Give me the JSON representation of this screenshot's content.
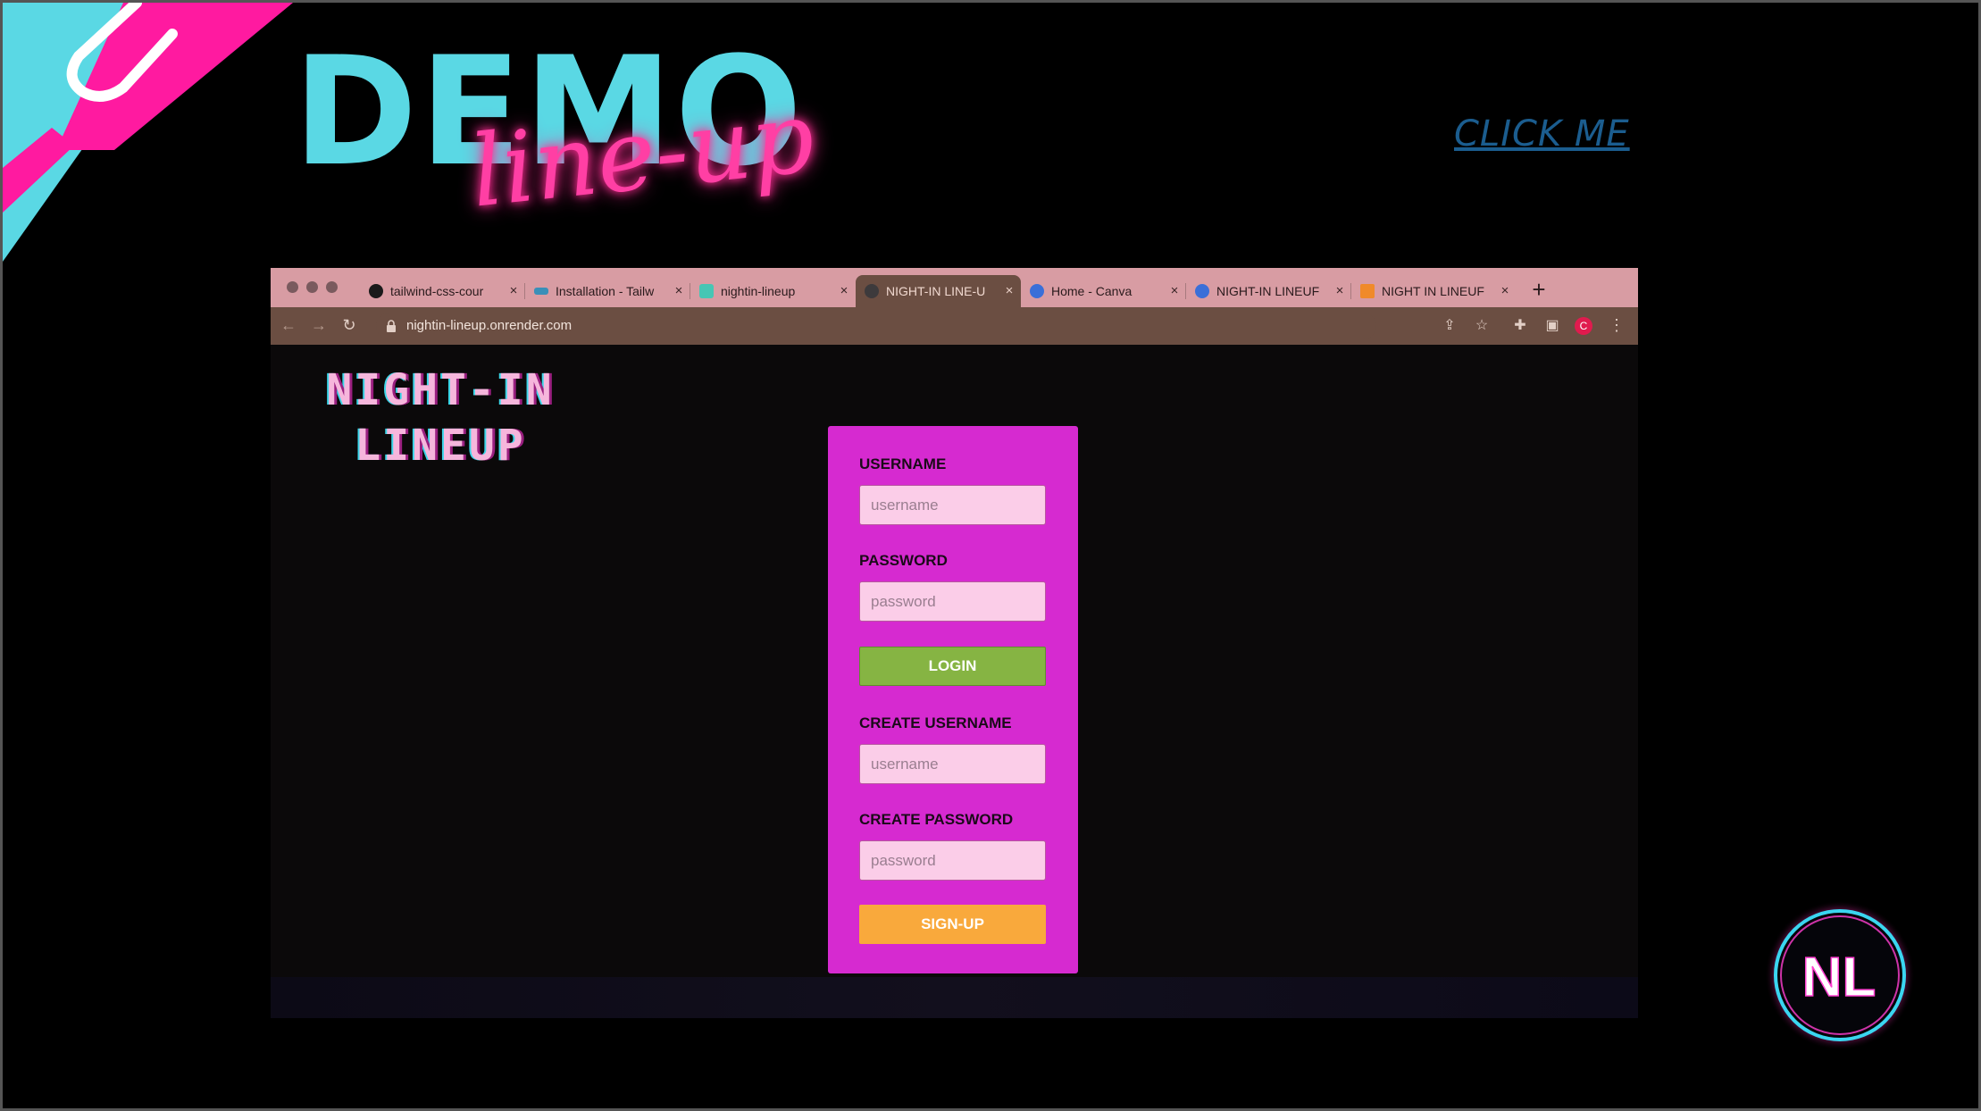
{
  "slide": {
    "title": "DEMO",
    "script_title": "line-up",
    "link_label": "CLICK ME",
    "badge_letters": "NL"
  },
  "browser": {
    "tabs": [
      {
        "label": "tailwind-css-cour",
        "icon": "github-icon",
        "active": false
      },
      {
        "label": "Installation - Tailw",
        "icon": "tailwind-icon",
        "active": false
      },
      {
        "label": "nightin-lineup",
        "icon": "render-icon",
        "active": false
      },
      {
        "label": "NIGHT-IN LINE-U",
        "icon": "page-icon",
        "active": true
      },
      {
        "label": "Home - Canva",
        "icon": "canva-icon",
        "active": false
      },
      {
        "label": "NIGHT-IN LINEUF",
        "icon": "canva-icon",
        "active": false
      },
      {
        "label": "NIGHT IN LINEUF",
        "icon": "slides-icon",
        "active": false
      }
    ],
    "url": "nightin-lineup.onrender.com",
    "profile_initial": "C"
  },
  "app": {
    "logo_line1": "NIGHT-IN",
    "logo_line2": "LINEUP",
    "login": {
      "username_label": "USERNAME",
      "username_placeholder": "username",
      "password_label": "PASSWORD",
      "password_placeholder": "password",
      "button": "LOGIN"
    },
    "signup": {
      "username_label": "CREATE USERNAME",
      "username_placeholder": "username",
      "password_label": "CREATE PASSWORD",
      "password_placeholder": "password",
      "button": "SIGN-UP"
    }
  },
  "colors": {
    "accent_cyan": "#5ad8e4",
    "accent_pink": "#ff3fa4",
    "form_bg": "#d62ad0",
    "login_button": "#86b443",
    "signup_button": "#f9a93c"
  }
}
